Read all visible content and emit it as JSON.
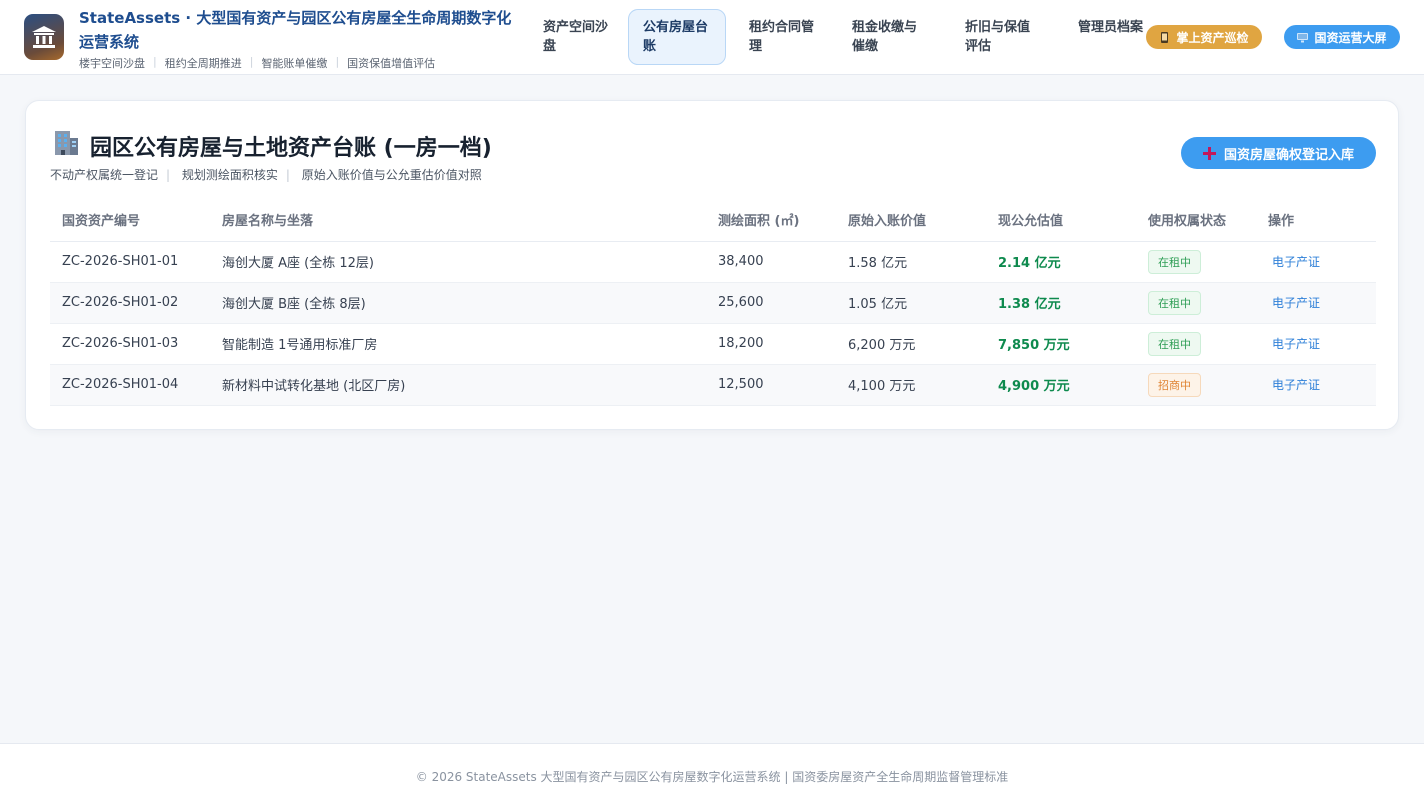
{
  "app": {
    "title_main": "StateAssets · 大型国有资产与园区公有房屋全生命周期数字化",
    "title_tail": "运营系统",
    "subnav": [
      "楼宇空间沙盘",
      "租约全周期推进",
      "智能账单催缴",
      "国资保值增值评估"
    ]
  },
  "nav": {
    "items": [
      "资产空间沙盘",
      "公有房屋台账",
      "租约合同管理",
      "租金收缴与催缴",
      "折旧与保值评估",
      "管理员档案"
    ],
    "active": "公有房屋台账"
  },
  "actions": {
    "patrol": "掌上资产巡检",
    "screen": "国资运营大屏"
  },
  "ledger": {
    "title": "园区公有房屋与土地资产台账 (一房一档)",
    "subtitle": [
      "不动产权属统一登记",
      "规划测绘面积核实",
      "原始入账价值与公允重估价值对照"
    ],
    "add_button": "国资房屋确权登记入库",
    "columns": [
      "国资资产编号",
      "房屋名称与坐落",
      "测绘面积 (㎡)",
      "原始入账价值",
      "现公允估值",
      "使用权属状态",
      "操作"
    ],
    "rows": [
      {
        "id": "ZC-2026-SH01-01",
        "name": "海创大厦 A座 (全栋 12层)",
        "area": "38,400",
        "original": "1.58 亿元",
        "fair": "2.14 亿元",
        "status": "在租中",
        "action": "电子产证"
      },
      {
        "id": "ZC-2026-SH01-02",
        "name": "海创大厦 B座 (全栋 8层)",
        "area": "25,600",
        "original": "1.05 亿元",
        "fair": "1.38 亿元",
        "status": "在租中",
        "action": "电子产证"
      },
      {
        "id": "ZC-2026-SH01-03",
        "name": "智能制造 1号通用标准厂房",
        "area": "18,200",
        "original": "6,200 万元",
        "fair": "7,850 万元",
        "status": "在租中",
        "action": "电子产证"
      },
      {
        "id": "ZC-2026-SH01-04",
        "name": "新材料中试转化基地 (北区厂房)",
        "area": "12,500",
        "original": "4,100 万元",
        "fair": "4,900 万元",
        "status": "招商中",
        "action": "电子产证"
      }
    ]
  },
  "colors": {
    "accent": "#3d9cf0",
    "gold": "#e0a541",
    "value_green": "#0e8a4e",
    "status_rented": "#2f9e56",
    "status_leasing": "#e08434"
  },
  "icons": {
    "logo": "bank-building-icon",
    "patrol": "mobile-phone-icon",
    "screen": "monitor-icon",
    "ledger": "office-building-icon",
    "add": "plus-icon"
  },
  "footer": {
    "text": "© 2026 StateAssets 大型国有资产与园区公有房屋数字化运营系统 | 国资委房屋资产全生命周期监督管理标准"
  }
}
